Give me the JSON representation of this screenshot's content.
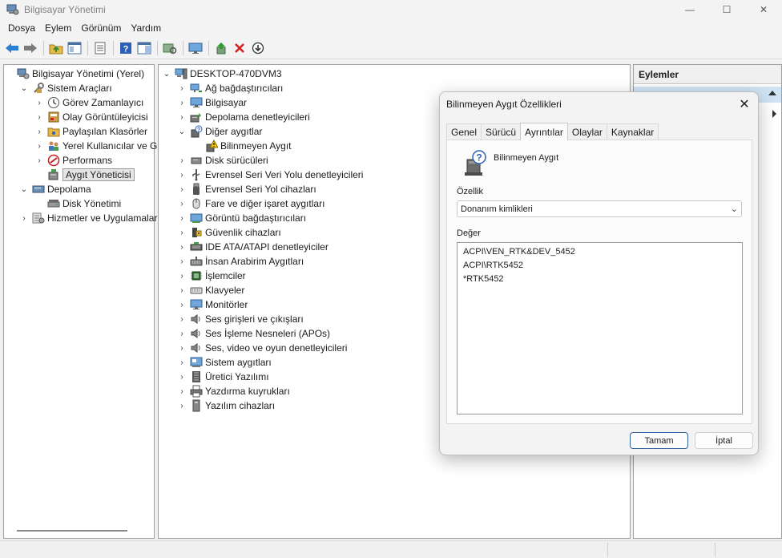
{
  "window": {
    "title": "Bilgisayar Yönetimi",
    "minimize": "—",
    "maximize": "☐",
    "close": "✕"
  },
  "menu": [
    "Dosya",
    "Eylem",
    "Görünüm",
    "Yardım"
  ],
  "left_tree": [
    {
      "label": "Bilgisayar Yönetimi (Yerel)",
      "icon": "computer-management-icon",
      "chevron": "",
      "level": 0
    },
    {
      "label": "Sistem Araçları",
      "icon": "tools-icon",
      "chevron": "⌄",
      "level": 1
    },
    {
      "label": "Görev Zamanlayıcı",
      "icon": "clock-icon",
      "chevron": "›",
      "level": 2
    },
    {
      "label": "Olay Görüntüleyicisi",
      "icon": "event-viewer-icon",
      "chevron": "›",
      "level": 2
    },
    {
      "label": "Paylaşılan Klasörler",
      "icon": "shared-folder-icon",
      "chevron": "›",
      "level": 2
    },
    {
      "label": "Yerel Kullanıcılar ve Gru",
      "icon": "users-icon",
      "chevron": "›",
      "level": 2
    },
    {
      "label": "Performans",
      "icon": "performance-icon",
      "chevron": "›",
      "level": 2
    },
    {
      "label": "Aygıt Yöneticisi",
      "icon": "device-manager-icon",
      "chevron": "",
      "level": 2,
      "selected": true
    },
    {
      "label": "Depolama",
      "icon": "storage-icon",
      "chevron": "⌄",
      "level": 1
    },
    {
      "label": "Disk Yönetimi",
      "icon": "disk-icon",
      "chevron": "",
      "level": 2
    },
    {
      "label": "Hizmetler ve Uygulamalar",
      "icon": "services-icon",
      "chevron": "›",
      "level": 1
    }
  ],
  "device_tree": {
    "root": "DESKTOP-470DVM3",
    "items": [
      {
        "label": "Ağ bağdaştırıcıları",
        "icon": "network-adapter-icon",
        "chevron": "›",
        "level": 1
      },
      {
        "label": "Bilgisayar",
        "icon": "monitor-icon",
        "chevron": "›",
        "level": 1
      },
      {
        "label": "Depolama denetleyicileri",
        "icon": "storage-controller-icon",
        "chevron": "›",
        "level": 1
      },
      {
        "label": "Diğer aygıtlar",
        "icon": "other-devices-icon",
        "chevron": "⌄",
        "level": 1
      },
      {
        "label": "Bilinmeyen Aygıt",
        "icon": "warning-device-icon",
        "chevron": "",
        "level": 2
      },
      {
        "label": "Disk sürücüleri",
        "icon": "disk-drive-icon",
        "chevron": "›",
        "level": 1
      },
      {
        "label": "Evrensel Seri Veri Yolu denetleyicileri",
        "icon": "usb-icon",
        "chevron": "›",
        "level": 1
      },
      {
        "label": "Evrensel Seri Yol cihazları",
        "icon": "usb-device-icon",
        "chevron": "›",
        "level": 1
      },
      {
        "label": "Fare ve diğer işaret aygıtları",
        "icon": "mouse-icon",
        "chevron": "›",
        "level": 1
      },
      {
        "label": "Görüntü bağdaştırıcıları",
        "icon": "display-adapter-icon",
        "chevron": "›",
        "level": 1
      },
      {
        "label": "Güvenlik cihazları",
        "icon": "security-device-icon",
        "chevron": "›",
        "level": 1
      },
      {
        "label": "IDE ATA/ATAPI denetleyiciler",
        "icon": "ide-icon",
        "chevron": "›",
        "level": 1
      },
      {
        "label": "İnsan Arabirim Aygıtları",
        "icon": "hid-icon",
        "chevron": "›",
        "level": 1
      },
      {
        "label": "İşlemciler",
        "icon": "processor-icon",
        "chevron": "›",
        "level": 1
      },
      {
        "label": "Klavyeler",
        "icon": "keyboard-icon",
        "chevron": "›",
        "level": 1
      },
      {
        "label": "Monitörler",
        "icon": "monitor-icon",
        "chevron": "›",
        "level": 1
      },
      {
        "label": "Ses girişleri ve çıkışları",
        "icon": "speaker-icon",
        "chevron": "›",
        "level": 1
      },
      {
        "label": "Ses İşleme Nesneleri (APOs)",
        "icon": "speaker-icon",
        "chevron": "›",
        "level": 1
      },
      {
        "label": "Ses, video ve oyun denetleyicileri",
        "icon": "speaker-icon",
        "chevron": "›",
        "level": 1
      },
      {
        "label": "Sistem aygıtları",
        "icon": "system-device-icon",
        "chevron": "›",
        "level": 1
      },
      {
        "label": "Üretici Yazılımı",
        "icon": "firmware-icon",
        "chevron": "›",
        "level": 1
      },
      {
        "label": "Yazdırma kuyrukları",
        "icon": "printer-icon",
        "chevron": "›",
        "level": 1
      },
      {
        "label": "Yazılım cihazları",
        "icon": "software-device-icon",
        "chevron": "›",
        "level": 1
      }
    ]
  },
  "actions_pane": {
    "header": "Eylemler"
  },
  "dialog": {
    "title": "Bilinmeyen Aygıt Özellikleri",
    "close": "✕",
    "tabs": [
      "Genel",
      "Sürücü",
      "Ayrıntılar",
      "Olaylar",
      "Kaynaklar"
    ],
    "active_tab": "Ayrıntılar",
    "device_name": "Bilinmeyen Aygıt",
    "property_label": "Özellik",
    "property_value": "Donanım kimlikleri",
    "value_label": "Değer",
    "values": [
      "ACPI\\VEN_RTK&DEV_5452",
      "ACPI\\RTK5452",
      "*RTK5452"
    ],
    "ok": "Tamam",
    "cancel": "İptal"
  },
  "colors": {
    "accent": "#2c5f9e",
    "selection": "#cfe3f5",
    "warning": "#f2c400",
    "danger": "#d42020"
  }
}
